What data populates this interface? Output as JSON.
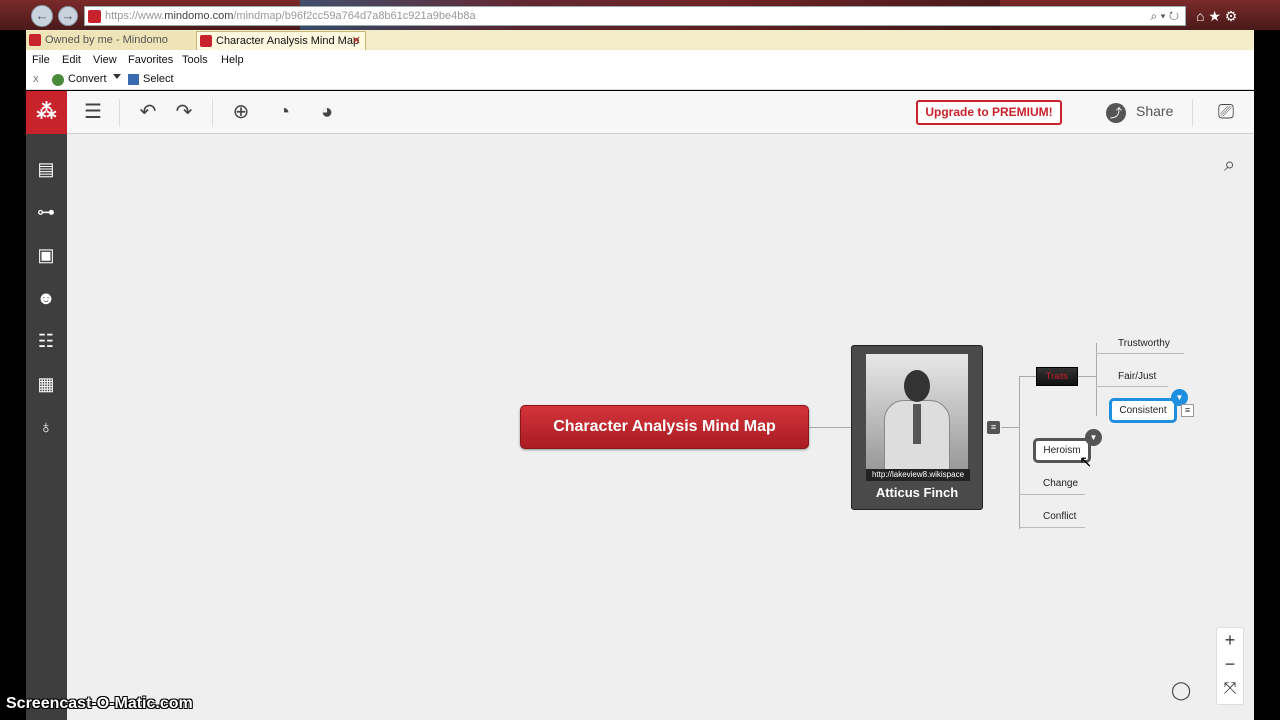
{
  "browser": {
    "url_prefix": "https://www.",
    "url_domain": "mindomo.com",
    "url_rest": "/mindmap/b96f2cc59a764d7a8b61c921a9be4b8a",
    "tabs": [
      {
        "label": "Owned by me - Mindomo"
      },
      {
        "label": "Character Analysis Mind Map",
        "close": "✕"
      }
    ],
    "menu": [
      "File",
      "Edit",
      "View",
      "Favorites",
      "Tools",
      "Help"
    ],
    "cmd": {
      "close": "x",
      "convert": "Convert",
      "select": "Select"
    },
    "addr_icons": "⌕ ▾ ↻",
    "right_icons": "⌂ ★ ⚙"
  },
  "toolbar": {
    "upgrade_label": "Upgrade to PREMIUM!",
    "share_label": "Share"
  },
  "mindmap": {
    "central": "Character Analysis Mind Map",
    "main_topic": {
      "label": "Atticus Finch",
      "image_caption": "http://lakeview8.wikispace"
    },
    "branches": {
      "traits": "Traits",
      "trait_items": [
        "Trustworthy",
        "Fair/Just",
        "Consistent"
      ],
      "others": [
        "Heroism",
        "Change",
        "Conflict"
      ]
    }
  },
  "zoom": {
    "in": "+",
    "out": "−",
    "fit": "⤧"
  },
  "watermark": "Screencast-O-Matic.com",
  "colors": {
    "brand": "#c8232c",
    "selection": "#1f8fe0",
    "sidebar": "#3e3e3e",
    "canvas": "#efefef"
  }
}
